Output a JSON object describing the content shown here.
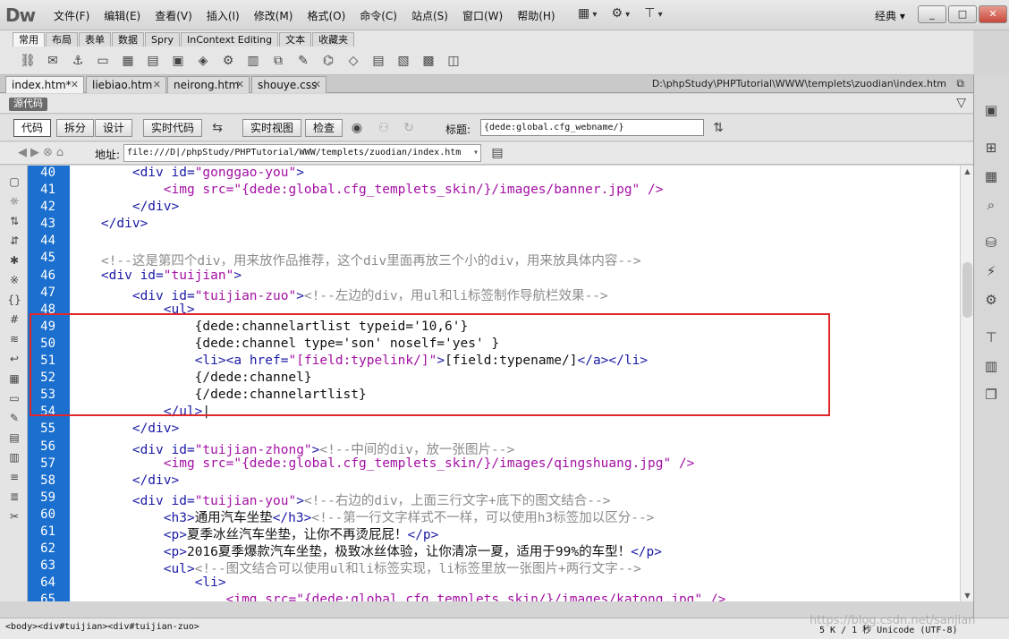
{
  "app": {
    "logo": "Dw",
    "menus": [
      "文件(F)",
      "编辑(E)",
      "查看(V)",
      "插入(I)",
      "修改(M)",
      "格式(O)",
      "命令(C)",
      "站点(S)",
      "窗口(W)",
      "帮助(H)"
    ],
    "workspace": "经典 ▾",
    "window_controls": [
      "_",
      "□",
      "✕"
    ],
    "menu_tool_icons": [
      "layout-icon",
      "gear-icon",
      "site-icon"
    ]
  },
  "insert_bar": {
    "tabs": [
      "常用",
      "布局",
      "表单",
      "数据",
      "Spry",
      "InContext Editing",
      "文本",
      "收藏夹"
    ],
    "active_tab": 0,
    "icon_count": 18
  },
  "document_tabs": [
    {
      "label": "index.htm*",
      "active": true
    },
    {
      "label": "liebiao.htm",
      "active": false
    },
    {
      "label": "neirong.htm",
      "active": false
    },
    {
      "label": "shouye.css",
      "active": false
    }
  ],
  "document_path": "D:\\phpStudy\\PHPTutorial\\WWW\\templets\\zuodian\\index.htm",
  "source_badge": "源代码",
  "toolbar": {
    "code": "代码",
    "split": "拆分",
    "design": "设计",
    "live_code": "实时代码",
    "live_view": "实时视图",
    "inspect": "检查",
    "title_label": "标题:",
    "title_value": "{dede:global.cfg_webname/}"
  },
  "address": {
    "label": "地址:",
    "value": "file:///D|/phpStudy/PHPTutorial/WWW/templets/zuodian/index.htm"
  },
  "colors": {
    "tag": "#1a1aa6",
    "attr": "#1a1aa6",
    "value": "#a310a3",
    "comment": "#8b8b8b",
    "text": "#111111",
    "gutter": "#1a6fcf",
    "highlight": "#e0272a"
  },
  "editor": {
    "highlight_lines": [
      49,
      54
    ],
    "lines": [
      {
        "n": "40",
        "t": [
          [
            "        ",
            ""
          ],
          [
            "<div ",
            "tag"
          ],
          [
            "id=",
            "attr"
          ],
          [
            "\"gonggao-you\"",
            "value"
          ],
          [
            ">",
            "tag"
          ]
        ]
      },
      {
        "n": "41",
        "t": [
          [
            "            ",
            ""
          ],
          [
            "<img ",
            "value"
          ],
          [
            "src=",
            "value"
          ],
          [
            "\"{dede:global.cfg_templets_skin/}/images/banner.jpg\"",
            "value"
          ],
          [
            " />",
            "value"
          ]
        ]
      },
      {
        "n": "42",
        "t": [
          [
            "        ",
            ""
          ],
          [
            "</div>",
            "tag"
          ]
        ]
      },
      {
        "n": "43",
        "t": [
          [
            "    ",
            ""
          ],
          [
            "</div>",
            "tag"
          ]
        ]
      },
      {
        "n": "44",
        "t": [
          [
            "",
            ""
          ]
        ]
      },
      {
        "n": "45",
        "t": [
          [
            "    ",
            ""
          ],
          [
            "<!--这是第四个div，用来放作品推荐，这个div里面再放三个小的div，用来放具体内容-->",
            "comment"
          ]
        ]
      },
      {
        "n": "46",
        "t": [
          [
            "    ",
            ""
          ],
          [
            "<div ",
            "tag"
          ],
          [
            "id=",
            "attr"
          ],
          [
            "\"tuijian\"",
            "value"
          ],
          [
            ">",
            "tag"
          ]
        ]
      },
      {
        "n": "47",
        "t": [
          [
            "        ",
            ""
          ],
          [
            "<div ",
            "tag"
          ],
          [
            "id=",
            "attr"
          ],
          [
            "\"tuijian-zuo\"",
            "value"
          ],
          [
            ">",
            "tag"
          ],
          [
            "<!--左边的div，用ul和li标签制作导航栏效果-->",
            "comment"
          ]
        ]
      },
      {
        "n": "48",
        "t": [
          [
            "            ",
            ""
          ],
          [
            "<ul>",
            "tag"
          ]
        ]
      },
      {
        "n": "49",
        "t": [
          [
            "                {dede:channelartlist typeid='10,6'}",
            "text"
          ]
        ]
      },
      {
        "n": "50",
        "t": [
          [
            "                {dede:channel type='son' noself='yes' }",
            "text"
          ]
        ]
      },
      {
        "n": "51",
        "t": [
          [
            "                ",
            ""
          ],
          [
            "<li>",
            "tag"
          ],
          [
            "<a ",
            "tag"
          ],
          [
            "href=",
            "attr"
          ],
          [
            "\"[field:typelink/]\"",
            "value"
          ],
          [
            ">",
            "tag"
          ],
          [
            "[field:typename/]",
            "text"
          ],
          [
            "</a>",
            "tag"
          ],
          [
            "</li>",
            "tag"
          ]
        ]
      },
      {
        "n": "52",
        "t": [
          [
            "                {/dede:channel}",
            "text"
          ]
        ]
      },
      {
        "n": "53",
        "t": [
          [
            "                {/dede:channelartlist}",
            "text"
          ]
        ]
      },
      {
        "n": "54",
        "t": [
          [
            "            ",
            ""
          ],
          [
            "</ul>",
            "tag"
          ],
          [
            "|",
            "text"
          ]
        ]
      },
      {
        "n": "55",
        "t": [
          [
            "        ",
            ""
          ],
          [
            "</div>",
            "tag"
          ]
        ]
      },
      {
        "n": "56",
        "t": [
          [
            "        ",
            ""
          ],
          [
            "<div ",
            "tag"
          ],
          [
            "id=",
            "attr"
          ],
          [
            "\"tuijian-zhong\"",
            "value"
          ],
          [
            ">",
            "tag"
          ],
          [
            "<!--中间的div，放一张图片-->",
            "comment"
          ]
        ]
      },
      {
        "n": "57",
        "t": [
          [
            "            ",
            ""
          ],
          [
            "<img ",
            "value"
          ],
          [
            "src=",
            "value"
          ],
          [
            "\"{dede:global.cfg_templets_skin/}/images/qingshuang.jpg\"",
            "value"
          ],
          [
            " />",
            "value"
          ]
        ]
      },
      {
        "n": "58",
        "t": [
          [
            "        ",
            ""
          ],
          [
            "</div>",
            "tag"
          ]
        ]
      },
      {
        "n": "59",
        "t": [
          [
            "        ",
            ""
          ],
          [
            "<div ",
            "tag"
          ],
          [
            "id=",
            "attr"
          ],
          [
            "\"tuijian-you\"",
            "value"
          ],
          [
            ">",
            "tag"
          ],
          [
            "<!--右边的div，上面三行文字+底下的图文结合-->",
            "comment"
          ]
        ]
      },
      {
        "n": "60",
        "t": [
          [
            "            ",
            ""
          ],
          [
            "<h3>",
            "tag"
          ],
          [
            "通用汽车坐垫",
            "text"
          ],
          [
            "</h3>",
            "tag"
          ],
          [
            "<!--第一行文字样式不一样，可以使用h3标签加以区分-->",
            "comment"
          ]
        ]
      },
      {
        "n": "61",
        "t": [
          [
            "            ",
            ""
          ],
          [
            "<p>",
            "tag"
          ],
          [
            "夏季冰丝汽车坐垫，让你不再烫屁屁！",
            "text"
          ],
          [
            "</p>",
            "tag"
          ]
        ]
      },
      {
        "n": "62",
        "t": [
          [
            "            ",
            ""
          ],
          [
            "<p>",
            "tag"
          ],
          [
            "2016夏季爆款汽车坐垫，极致冰丝体验，让你清凉一夏，适用于99%的车型！",
            "text"
          ],
          [
            "</p>",
            "tag"
          ]
        ]
      },
      {
        "n": "63",
        "t": [
          [
            "            ",
            ""
          ],
          [
            "<ul>",
            "tag"
          ],
          [
            "<!--图文结合可以使用ul和li标签实现，li标签里放一张图片+两行文字-->",
            "comment"
          ]
        ]
      },
      {
        "n": "64",
        "t": [
          [
            "                ",
            ""
          ],
          [
            "<li>",
            "tag"
          ]
        ]
      },
      {
        "n": "65",
        "t": [
          [
            "                    ",
            ""
          ],
          [
            "<img ",
            "value"
          ],
          [
            "src=",
            "value"
          ],
          [
            "\"{dede:global.cfg_templets_skin/}/images/katong.jpg\"",
            "value"
          ],
          [
            " />",
            "value"
          ]
        ]
      }
    ]
  },
  "status": {
    "tag_selector": "<body><div#tuijian><div#tuijian-zuo>",
    "info": "5 K / 1 秒  Unicode (UTF-8)"
  },
  "watermark": "https://blog.csdn.net/sanjian"
}
